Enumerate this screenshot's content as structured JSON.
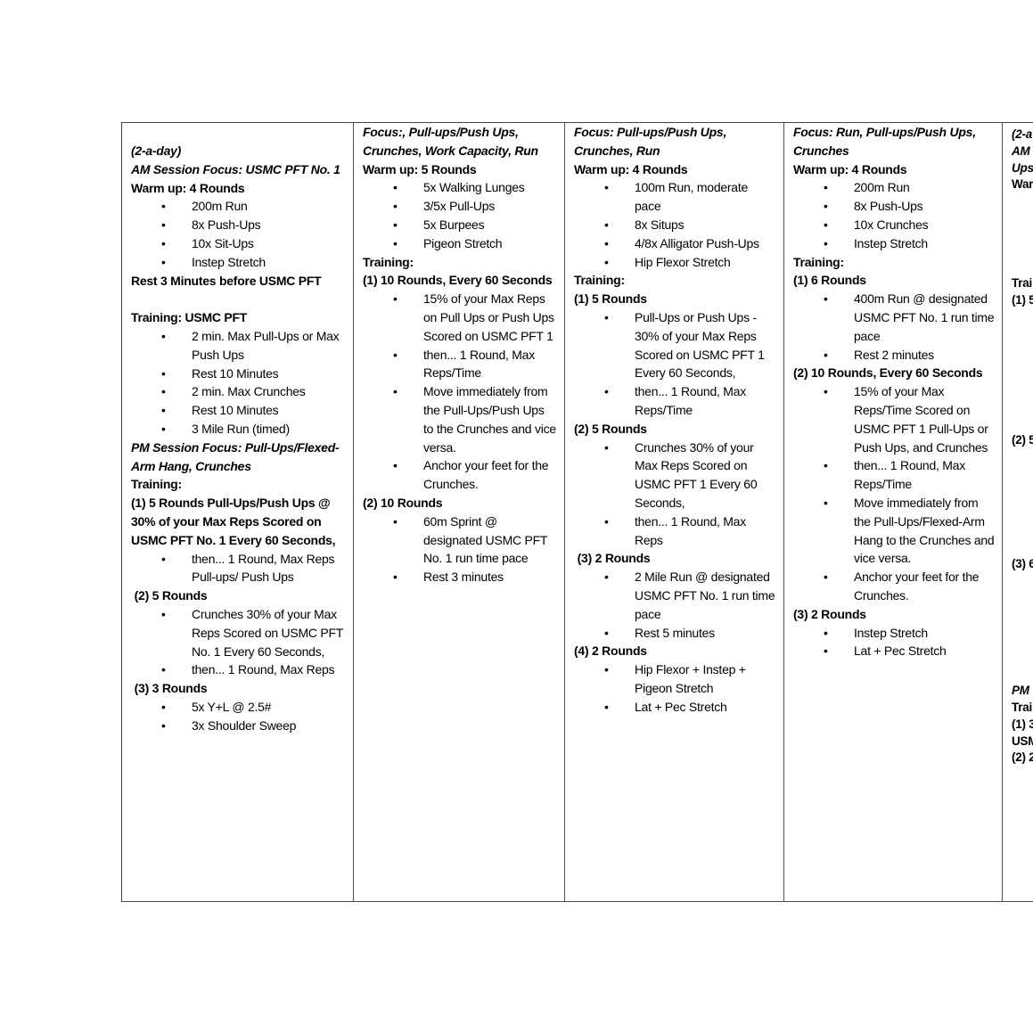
{
  "columns": [
    [
      {
        "t": "bi",
        "text": "(2-a-day)"
      },
      {
        "t": "bi",
        "text": "AM Session Focus: USMC PFT No. 1"
      },
      {
        "t": "b",
        "text": "Warm up: 4 Rounds"
      },
      {
        "t": "li",
        "text": "200m Run"
      },
      {
        "t": "li",
        "text": "8x Push-Ups"
      },
      {
        "t": "li",
        "text": "10x Sit-Ups"
      },
      {
        "t": "li",
        "text": "Instep Stretch"
      },
      {
        "t": "b",
        "text": "Rest 3 Minutes before USMC PFT"
      },
      {
        "t": "blank",
        "text": ""
      },
      {
        "t": "b",
        "text": "Training: USMC PFT"
      },
      {
        "t": "li",
        "text": "2 min. Max Pull-Ups or Max Push Ups"
      },
      {
        "t": "li",
        "text": "Rest 10 Minutes"
      },
      {
        "t": "li",
        "text": "2 min. Max Crunches"
      },
      {
        "t": "li",
        "text": "Rest 10 Minutes"
      },
      {
        "t": "li",
        "text": "3 Mile Run (timed)"
      },
      {
        "t": "bi",
        "text": "PM Session Focus: Pull-Ups/Flexed-Arm Hang, Crunches"
      },
      {
        "t": "b",
        "text": "Training:"
      },
      {
        "t": "b",
        "text": "(1) 5 Rounds Pull-Ups/Push Ups @ 30% of your Max Reps Scored on USMC PFT No. 1 Every 60 Seconds,"
      },
      {
        "t": "li",
        "text": "then... 1 Round, Max Reps Pull-ups/ Push Ups"
      },
      {
        "t": "b",
        "text": " (2) 5 Rounds"
      },
      {
        "t": "li",
        "text": "Crunches 30% of your Max Reps Scored on USMC PFT No. 1 Every 60 Seconds,"
      },
      {
        "t": "li",
        "text": "then... 1 Round, Max Reps"
      },
      {
        "t": "b",
        "text": " (3) 3 Rounds"
      },
      {
        "t": "li",
        "text": "5x Y+L @ 2.5#"
      },
      {
        "t": "li",
        "text": "3x Shoulder Sweep"
      }
    ],
    [
      {
        "t": "bi",
        "text": "Focus:, Pull-ups/Push Ups, Crunches, Work Capacity, Run"
      },
      {
        "t": "b",
        "text": "Warm up: 5 Rounds"
      },
      {
        "t": "li",
        "text": "5x Walking Lunges"
      },
      {
        "t": "li",
        "text": "3/5x Pull-Ups"
      },
      {
        "t": "li",
        "text": "5x Burpees"
      },
      {
        "t": "li",
        "text": "Pigeon Stretch"
      },
      {
        "t": "b",
        "text": "Training:"
      },
      {
        "t": "b",
        "text": "(1) 10 Rounds, Every 60 Seconds"
      },
      {
        "t": "li",
        "text": "15% of your Max Reps on Pull Ups or Push Ups Scored on USMC PFT 1"
      },
      {
        "t": "li",
        "text": "then... 1 Round, Max Reps/Time"
      },
      {
        "t": "li",
        "text": "Move immediately from the Pull-Ups/Push Ups to the Crunches and vice versa."
      },
      {
        "t": "li",
        "text": "Anchor your feet for the Crunches."
      },
      {
        "t": "b",
        "text": "(2) 10 Rounds"
      },
      {
        "t": "li",
        "text": "60m Sprint @ designated USMC PFT No. 1 run time pace"
      },
      {
        "t": "li",
        "text": "Rest 3 minutes"
      }
    ],
    [
      {
        "t": "bi",
        "text": "Focus: Pull-ups/Push Ups, Crunches, Run"
      },
      {
        "t": "b",
        "text": "Warm up: 4 Rounds"
      },
      {
        "t": "li",
        "text": "100m Run, moderate pace"
      },
      {
        "t": "li",
        "text": "8x Situps"
      },
      {
        "t": "li",
        "text": "4/8x Alligator Push-Ups"
      },
      {
        "t": "li",
        "text": "Hip Flexor Stretch"
      },
      {
        "t": "b",
        "text": "Training:"
      },
      {
        "t": "b",
        "text": "(1) 5 Rounds"
      },
      {
        "t": "li",
        "text": "Pull-Ups or Push Ups - 30% of your Max Reps Scored on USMC PFT 1 Every 60 Seconds,"
      },
      {
        "t": "li",
        "text": "then... 1 Round, Max Reps/Time"
      },
      {
        "t": "b",
        "text": "(2) 5 Rounds"
      },
      {
        "t": "li",
        "text": "Crunches 30% of your Max Reps Scored on USMC PFT 1 Every 60 Seconds,"
      },
      {
        "t": "li",
        "text": "then... 1 Round, Max Reps"
      },
      {
        "t": "b",
        "text": " (3) 2 Rounds"
      },
      {
        "t": "li",
        "text": "2 Mile Run @ designated USMC PFT No. 1 run time pace"
      },
      {
        "t": "li",
        "text": "Rest 5 minutes"
      },
      {
        "t": "b",
        "text": "(4) 2 Rounds"
      },
      {
        "t": "li",
        "text": "Hip Flexor + Instep + Pigeon Stretch"
      },
      {
        "t": "li",
        "text": "Lat + Pec Stretch"
      }
    ],
    [
      {
        "t": "bi",
        "text": "Focus: Run, Pull-ups/Push Ups, Crunches"
      },
      {
        "t": "b",
        "text": "Warm up: 4 Rounds"
      },
      {
        "t": "li",
        "text": "200m Run"
      },
      {
        "t": "li",
        "text": "8x Push-Ups"
      },
      {
        "t": "li",
        "text": "10x Crunches"
      },
      {
        "t": "li",
        "text": "Instep Stretch"
      },
      {
        "t": "b",
        "text": "Training:"
      },
      {
        "t": "b",
        "text": "(1) 6 Rounds"
      },
      {
        "t": "li",
        "text": "400m Run @ designated USMC PFT No. 1 run time pace"
      },
      {
        "t": "li",
        "text": "Rest 2 minutes"
      },
      {
        "t": "b",
        "text": "(2) 10 Rounds, Every 60 Seconds"
      },
      {
        "t": "li",
        "text": "15% of your Max Reps/Time Scored on USMC PFT 1 Pull-Ups or Push Ups, and Crunches"
      },
      {
        "t": "li",
        "text": "then... 1 Round, Max Reps/Time"
      },
      {
        "t": "li",
        "text": "Move immediately from the Pull-Ups/Flexed-Arm Hang to the Crunches and vice versa."
      },
      {
        "t": "li",
        "text": "Anchor your feet for the Crunches."
      },
      {
        "t": "b",
        "text": "(3) 2 Rounds"
      },
      {
        "t": "li",
        "text": "Instep Stretch"
      },
      {
        "t": "li",
        "text": "Lat + Pec Stretch"
      }
    ]
  ],
  "partial_column": [
    {
      "t": "bi",
      "text": "(2-a"
    },
    {
      "t": "bi",
      "text": "AM"
    },
    {
      "t": "bi",
      "text": "Ups,"
    },
    {
      "t": "b",
      "text": "War"
    },
    {
      "t": "b",
      "text": "Trai"
    },
    {
      "t": "b",
      "text": "(1) 5"
    },
    {
      "t": "b",
      "text": "(2) 5"
    },
    {
      "t": "b",
      "text": "(3) 6"
    },
    {
      "t": "bi",
      "text": "PM"
    },
    {
      "t": "b",
      "text": "Trai"
    },
    {
      "t": "b",
      "text": "(1) 3"
    },
    {
      "t": "b",
      "text": "USM"
    },
    {
      "t": "b",
      "text": "(2) 2"
    }
  ],
  "bullet_glyph": "•"
}
